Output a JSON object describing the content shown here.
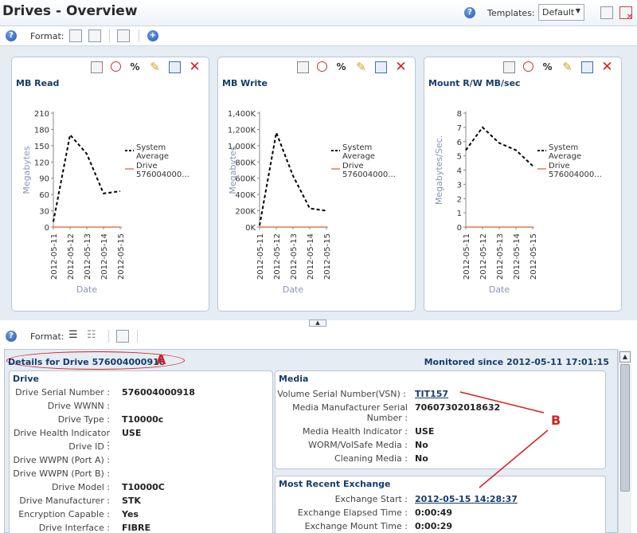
{
  "page": {
    "title": "Drives - Overview"
  },
  "header": {
    "templates_label": "Templates:",
    "template_value": "Default"
  },
  "toolbar_top": {
    "format_label": "Format:"
  },
  "toolbar_bottom": {
    "format_label": "Format:"
  },
  "charts": [
    {
      "title": "MB Read",
      "ylabel": "Megabytes",
      "xlabel": "Date",
      "ticks": [
        "0",
        "30",
        "60",
        "90",
        "120",
        "150",
        "180",
        "210"
      ],
      "legend": [
        {
          "name": "System Average"
        },
        {
          "name": "Drive 576004000..."
        }
      ]
    },
    {
      "title": "MB Write",
      "ylabel": "Megabytes",
      "xlabel": "Date",
      "ticks": [
        "0K",
        "200K",
        "400K",
        "600K",
        "800K",
        "1,000K",
        "1,200K",
        "1,400K"
      ],
      "legend": [
        {
          "name": "System Average"
        },
        {
          "name": "Drive 576004000..."
        }
      ]
    },
    {
      "title": "Mount R/W MB/sec",
      "ylabel": "Megabytes/Sec.",
      "xlabel": "Date",
      "ticks": [
        "0",
        "1",
        "2",
        "3",
        "4",
        "5",
        "6",
        "7",
        "8"
      ],
      "legend": [
        {
          "name": "System Average"
        },
        {
          "name": "Drive 576004000..."
        }
      ]
    }
  ],
  "chart_data": [
    {
      "type": "line",
      "title": "MB Read",
      "xlabel": "Date",
      "ylabel": "Megabytes",
      "x": [
        "2012-05-11",
        "2012-05-12",
        "2012-05-13",
        "2012-05-14",
        "2012-05-15"
      ],
      "ylim": [
        0,
        210
      ],
      "series": [
        {
          "name": "System Average",
          "style": "dashed",
          "color": "#000000",
          "x": [
            0,
            1,
            2,
            3,
            4
          ],
          "values": [
            10,
            170,
            135,
            62,
            66
          ]
        },
        {
          "name": "Drive 576004000...",
          "style": "solid",
          "color": "#e05a20",
          "x": [
            0,
            1,
            2,
            3,
            4
          ],
          "values": [
            0,
            0,
            0,
            0,
            0
          ]
        }
      ]
    },
    {
      "type": "line",
      "title": "MB Write",
      "xlabel": "Date",
      "ylabel": "Megabytes",
      "x": [
        "2012-05-11",
        "2012-05-12",
        "2012-05-13",
        "2012-05-14",
        "2012-05-15"
      ],
      "ylim": [
        0,
        1400
      ],
      "series": [
        {
          "name": "System Average",
          "style": "dashed",
          "color": "#000000",
          "x": [
            0,
            1,
            2,
            3,
            4
          ],
          "values": [
            20,
            1160,
            630,
            230,
            200
          ]
        },
        {
          "name": "Drive 576004000...",
          "style": "solid",
          "color": "#e05a20",
          "x": [
            0,
            1,
            2,
            3,
            4
          ],
          "values": [
            0,
            0,
            0,
            0,
            0
          ]
        }
      ]
    },
    {
      "type": "line",
      "title": "Mount R/W MB/sec",
      "xlabel": "Date",
      "ylabel": "Megabytes/Sec.",
      "x": [
        "2012-05-11",
        "2012-05-12",
        "2012-05-13",
        "2012-05-14",
        "2012-05-15"
      ],
      "ylim": [
        0,
        8
      ],
      "series": [
        {
          "name": "System Average",
          "style": "dashed",
          "color": "#000000",
          "x": [
            0,
            1,
            2,
            3,
            4
          ],
          "values": [
            5.4,
            7.0,
            5.9,
            5.4,
            4.3
          ]
        },
        {
          "name": "Drive 576004000...",
          "style": "solid",
          "color": "#e05a20",
          "x": [
            0,
            1,
            2,
            3,
            4
          ],
          "values": [
            0,
            0,
            0,
            0,
            0
          ]
        }
      ]
    }
  ],
  "details": {
    "title": "Details for Drive 576004000918",
    "monitored": "Monitored since 2012-05-11 17:01:15",
    "annotation_a": "A",
    "annotation_b": "B",
    "drive": {
      "title": "Drive",
      "rows": [
        {
          "label": "Drive Serial Number :",
          "value": "576004000918"
        },
        {
          "label": "Drive WWNN :",
          "value": ""
        },
        {
          "label": "Drive Type :",
          "value": "T10000c"
        },
        {
          "label": "Drive Health Indicator :",
          "value": "USE"
        },
        {
          "label": "Drive ID :",
          "value": ""
        },
        {
          "label": "Drive WWPN (Port A) :",
          "value": ""
        },
        {
          "label": "Drive WWPN (Port B) :",
          "value": ""
        },
        {
          "label": "Drive Model :",
          "value": "T10000C"
        },
        {
          "label": "Drive Manufacturer :",
          "value": "STK"
        },
        {
          "label": "Encryption Capable :",
          "value": "Yes"
        },
        {
          "label": "Drive Interface :",
          "value": "FIBRE"
        }
      ]
    },
    "media": {
      "title": "Media",
      "vsn_label": "Volume Serial Number(VSN) :",
      "vsn_value": "TIT157",
      "mfr_label_1": "Media Manufacturer Serial",
      "mfr_label_2": "Number :",
      "mfr_value": "70607302018632",
      "health_label": "Media Health Indicator :",
      "health_value": "USE",
      "worm_label": "WORM/VolSafe Media :",
      "worm_value": "No",
      "cleaning_label": "Cleaning Media :",
      "cleaning_value": "No"
    },
    "exchange": {
      "title": "Most Recent Exchange",
      "rows": [
        {
          "label": "Exchange Start :",
          "value": "2012-05-15 14:28:37",
          "link": true
        },
        {
          "label": "Exchange Elapsed Time :",
          "value": "0:00:49",
          "link": false
        },
        {
          "label": "Exchange Mount Time :",
          "value": "0:00:29",
          "link": false
        }
      ]
    }
  }
}
